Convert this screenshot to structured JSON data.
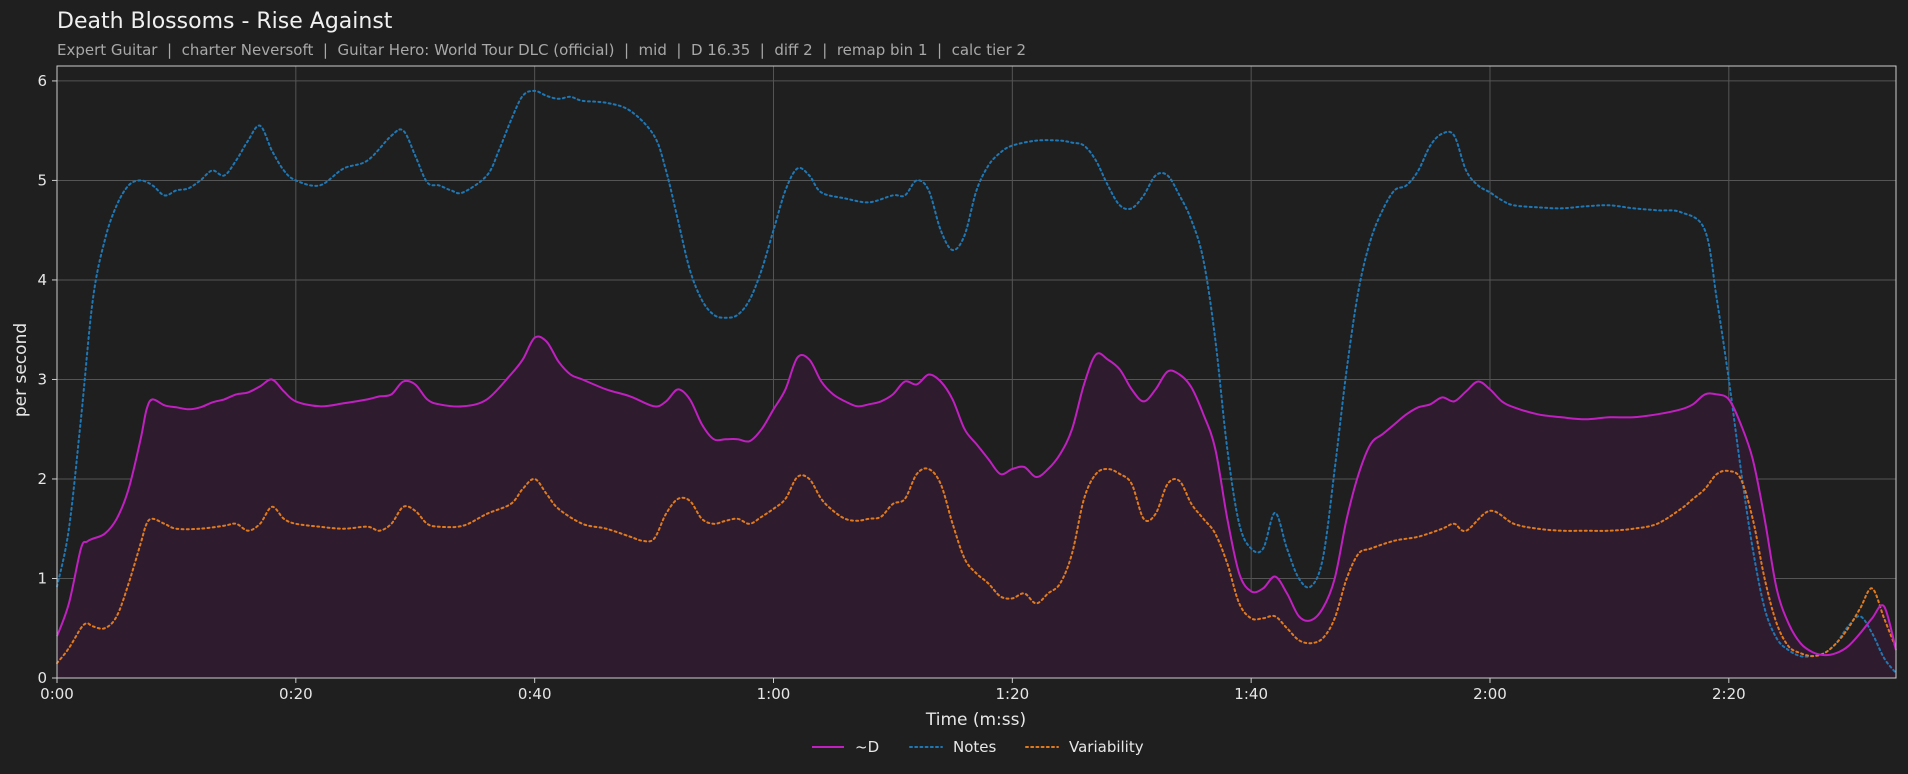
{
  "chart_data": {
    "type": "line",
    "title": "Death Blossoms - Rise Against",
    "subtitle": "Expert Guitar  |  charter Neversoft  |  Guitar Hero: World Tour DLC (official)  |  mid  |  D 16.35  |  diff 2  |  remap bin 1  |  calc tier 2",
    "xlabel": "Time (m:ss)",
    "ylabel": "per second",
    "xlim": [
      0,
      154
    ],
    "ylim": [
      0,
      6.15
    ],
    "xticks": [
      {
        "value": 0,
        "label": "0:00"
      },
      {
        "value": 20,
        "label": "0:20"
      },
      {
        "value": 40,
        "label": "0:40"
      },
      {
        "value": 60,
        "label": "1:00"
      },
      {
        "value": 80,
        "label": "1:20"
      },
      {
        "value": 100,
        "label": "1:40"
      },
      {
        "value": 120,
        "label": "2:00"
      },
      {
        "value": 140,
        "label": "2:20"
      }
    ],
    "yticks": [
      0,
      1,
      2,
      3,
      4,
      5,
      6
    ],
    "grid": true,
    "legend_position": "bottom-center",
    "colors": {
      "background": "#1f1f1f",
      "grid": "#555555",
      "axes": "#cccccc",
      "d": "#c020c0",
      "d_fill": "#2e1b2e",
      "notes": "#1f77b4",
      "variability": "#e07a1f"
    },
    "series": [
      {
        "name": "~D",
        "style": "solid",
        "fill": true,
        "x": [
          0,
          1,
          2,
          2.5,
          3,
          4,
          5,
          6,
          7,
          7.5,
          8,
          9,
          10,
          11,
          12,
          13,
          14,
          15,
          16,
          17,
          18,
          19,
          20,
          22,
          24,
          26,
          27,
          28,
          29,
          30,
          31,
          32,
          34,
          36,
          38,
          39,
          40,
          41,
          42,
          43,
          44,
          46,
          48,
          50,
          51,
          52,
          53,
          54,
          55,
          56,
          57,
          58,
          59,
          60,
          61,
          62,
          63,
          64,
          65,
          66,
          67,
          68,
          69,
          70,
          71,
          72,
          73,
          74,
          75,
          76,
          77,
          78,
          79,
          80,
          81,
          82,
          83,
          84,
          85,
          86,
          87,
          88,
          89,
          90,
          91,
          92,
          93,
          94,
          95,
          96,
          97,
          98,
          99,
          100,
          101,
          102,
          103,
          104,
          105,
          106,
          107,
          108,
          109,
          110,
          111,
          112,
          113,
          114,
          115,
          116,
          117,
          118,
          119,
          120,
          121,
          122,
          124,
          126,
          128,
          130,
          132,
          134,
          136,
          137,
          138,
          139,
          140,
          141,
          142,
          143,
          144,
          145,
          146,
          147,
          148,
          149,
          150,
          151,
          152,
          153,
          154
        ],
        "values": [
          0.42,
          0.75,
          1.3,
          1.37,
          1.4,
          1.45,
          1.6,
          1.9,
          2.4,
          2.7,
          2.8,
          2.74,
          2.72,
          2.7,
          2.72,
          2.77,
          2.8,
          2.85,
          2.87,
          2.93,
          3.0,
          2.88,
          2.78,
          2.73,
          2.76,
          2.8,
          2.83,
          2.85,
          2.98,
          2.95,
          2.8,
          2.75,
          2.73,
          2.8,
          3.05,
          3.2,
          3.42,
          3.38,
          3.18,
          3.05,
          3.0,
          2.9,
          2.83,
          2.73,
          2.78,
          2.9,
          2.8,
          2.55,
          2.4,
          2.4,
          2.4,
          2.38,
          2.5,
          2.7,
          2.9,
          3.22,
          3.2,
          2.98,
          2.85,
          2.78,
          2.73,
          2.75,
          2.78,
          2.85,
          2.98,
          2.95,
          3.05,
          2.98,
          2.8,
          2.5,
          2.35,
          2.2,
          2.05,
          2.1,
          2.12,
          2.02,
          2.1,
          2.25,
          2.5,
          2.95,
          3.25,
          3.2,
          3.1,
          2.9,
          2.78,
          2.9,
          3.08,
          3.05,
          2.92,
          2.65,
          2.3,
          1.6,
          1.05,
          0.87,
          0.9,
          1.02,
          0.85,
          0.62,
          0.58,
          0.7,
          1.0,
          1.6,
          2.05,
          2.35,
          2.45,
          2.55,
          2.65,
          2.72,
          2.75,
          2.82,
          2.78,
          2.88,
          2.98,
          2.9,
          2.78,
          2.72,
          2.65,
          2.62,
          2.6,
          2.62,
          2.62,
          2.65,
          2.7,
          2.75,
          2.85,
          2.85,
          2.8,
          2.55,
          2.2,
          1.6,
          0.9,
          0.55,
          0.35,
          0.26,
          0.23,
          0.25,
          0.32,
          0.45,
          0.6,
          0.72,
          0.28
        ]
      },
      {
        "name": "Notes",
        "style": "dotted",
        "fill": false,
        "x": [
          0,
          1,
          2,
          3,
          4,
          5,
          6,
          7,
          8,
          9,
          10,
          11,
          12,
          13,
          14,
          15,
          16,
          17,
          18,
          19,
          20,
          22,
          24,
          26,
          28,
          29,
          30,
          31,
          32,
          33,
          34,
          36,
          37,
          38,
          39,
          40,
          41,
          42,
          43,
          44,
          46,
          48,
          50,
          51,
          52,
          53,
          54,
          55,
          56,
          57,
          58,
          59,
          60,
          61,
          62,
          63,
          64,
          66,
          68,
          70,
          71,
          72,
          73,
          74,
          75,
          76,
          77,
          78,
          79,
          80,
          82,
          84,
          85,
          86,
          87,
          88,
          89,
          90,
          91,
          92,
          93,
          94,
          95,
          96,
          97,
          98,
          99,
          100,
          101,
          102,
          103,
          104,
          105,
          106,
          107,
          108,
          109,
          110,
          111,
          112,
          113,
          114,
          115,
          116,
          117,
          118,
          119,
          120,
          121,
          122,
          124,
          126,
          128,
          130,
          132,
          134,
          136,
          138,
          139,
          140,
          141,
          142,
          143,
          144,
          145,
          146,
          147,
          148,
          149,
          150,
          151,
          152,
          153,
          154
        ],
        "values": [
          0.92,
          1.5,
          2.6,
          3.8,
          4.4,
          4.75,
          4.95,
          5.0,
          4.95,
          4.85,
          4.9,
          4.92,
          5.0,
          5.1,
          5.05,
          5.2,
          5.4,
          5.55,
          5.3,
          5.1,
          5.0,
          4.95,
          5.12,
          5.2,
          5.45,
          5.5,
          5.25,
          4.98,
          4.95,
          4.9,
          4.88,
          5.05,
          5.3,
          5.6,
          5.85,
          5.9,
          5.85,
          5.82,
          5.84,
          5.8,
          5.78,
          5.7,
          5.45,
          5.1,
          4.6,
          4.1,
          3.8,
          3.65,
          3.62,
          3.65,
          3.8,
          4.1,
          4.5,
          4.9,
          5.12,
          5.05,
          4.88,
          4.82,
          4.78,
          4.85,
          4.85,
          5.0,
          4.9,
          4.5,
          4.3,
          4.45,
          4.9,
          5.15,
          5.28,
          5.35,
          5.4,
          5.4,
          5.38,
          5.35,
          5.2,
          4.95,
          4.75,
          4.72,
          4.85,
          5.05,
          5.05,
          4.85,
          4.6,
          4.2,
          3.4,
          2.3,
          1.55,
          1.3,
          1.3,
          1.66,
          1.3,
          1.0,
          0.92,
          1.2,
          2.1,
          3.1,
          3.9,
          4.4,
          4.7,
          4.9,
          4.95,
          5.1,
          5.35,
          5.47,
          5.45,
          5.1,
          4.95,
          4.88,
          4.8,
          4.75,
          4.73,
          4.72,
          4.74,
          4.75,
          4.72,
          4.7,
          4.68,
          4.5,
          3.8,
          3.0,
          2.1,
          1.3,
          0.7,
          0.4,
          0.28,
          0.22,
          0.22,
          0.25,
          0.35,
          0.52,
          0.62,
          0.45,
          0.2,
          0.05
        ]
      },
      {
        "name": "Variability",
        "style": "dotted",
        "fill": false,
        "x": [
          0,
          1,
          2,
          2.5,
          3,
          4,
          5,
          6,
          7,
          7.5,
          8,
          9,
          10,
          12,
          14,
          15,
          16,
          17,
          18,
          19,
          20,
          22,
          24,
          26,
          27,
          28,
          29,
          30,
          31,
          32,
          34,
          36,
          38,
          39,
          40,
          41,
          42,
          44,
          46,
          48,
          49,
          50,
          51,
          52,
          53,
          54,
          55,
          56,
          57,
          58,
          59,
          60,
          61,
          62,
          63,
          64,
          65,
          66,
          67,
          68,
          69,
          70,
          71,
          72,
          73,
          74,
          75,
          76,
          77,
          78,
          79,
          80,
          81,
          82,
          83,
          84,
          85,
          86,
          87,
          88,
          89,
          90,
          91,
          92,
          93,
          94,
          95,
          96,
          97,
          98,
          99,
          100,
          101,
          102,
          103,
          104,
          105,
          106,
          107,
          108,
          109,
          110,
          112,
          114,
          116,
          117,
          118,
          120,
          122,
          124,
          126,
          128,
          130,
          132,
          134,
          136,
          137,
          138,
          139,
          140,
          141,
          142,
          143,
          144,
          145,
          146,
          147,
          148,
          149,
          150,
          151,
          152,
          153,
          154
        ],
        "values": [
          0.15,
          0.3,
          0.5,
          0.55,
          0.52,
          0.5,
          0.62,
          0.95,
          1.35,
          1.55,
          1.6,
          1.55,
          1.5,
          1.5,
          1.53,
          1.55,
          1.48,
          1.55,
          1.72,
          1.6,
          1.55,
          1.52,
          1.5,
          1.52,
          1.48,
          1.55,
          1.72,
          1.68,
          1.55,
          1.52,
          1.53,
          1.65,
          1.75,
          1.9,
          2.0,
          1.85,
          1.7,
          1.55,
          1.5,
          1.42,
          1.38,
          1.4,
          1.65,
          1.8,
          1.78,
          1.6,
          1.55,
          1.58,
          1.6,
          1.55,
          1.62,
          1.7,
          1.8,
          2.02,
          2.0,
          1.8,
          1.68,
          1.6,
          1.58,
          1.6,
          1.62,
          1.75,
          1.8,
          2.05,
          2.1,
          1.95,
          1.55,
          1.2,
          1.05,
          0.95,
          0.82,
          0.8,
          0.85,
          0.75,
          0.85,
          0.95,
          1.25,
          1.8,
          2.05,
          2.1,
          2.05,
          1.95,
          1.6,
          1.65,
          1.95,
          1.98,
          1.75,
          1.6,
          1.45,
          1.15,
          0.75,
          0.6,
          0.6,
          0.62,
          0.5,
          0.38,
          0.35,
          0.4,
          0.6,
          1.0,
          1.25,
          1.3,
          1.38,
          1.42,
          1.5,
          1.55,
          1.48,
          1.68,
          1.55,
          1.5,
          1.48,
          1.48,
          1.48,
          1.5,
          1.55,
          1.7,
          1.8,
          1.9,
          2.05,
          2.08,
          2.0,
          1.6,
          1.0,
          0.55,
          0.32,
          0.25,
          0.22,
          0.25,
          0.35,
          0.5,
          0.7,
          0.9,
          0.6,
          0.3
        ]
      }
    ]
  }
}
